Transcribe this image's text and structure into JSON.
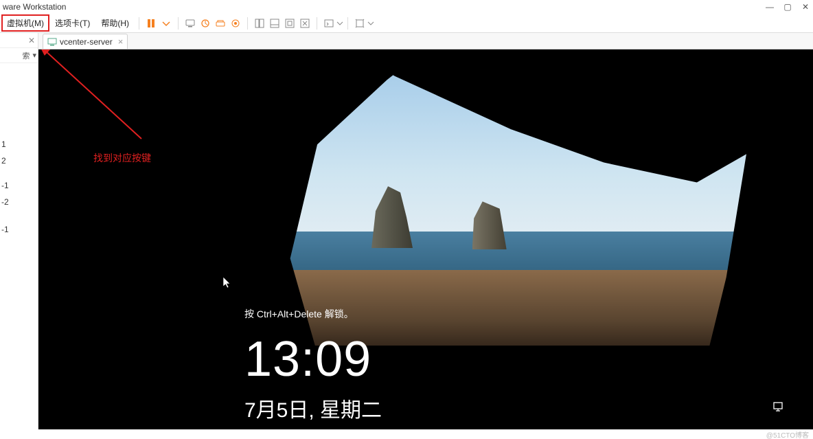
{
  "app": {
    "title": "ware Workstation"
  },
  "menu": {
    "vm": "虚拟机(M)",
    "tabs": "选项卡(T)",
    "help": "帮助(H)"
  },
  "sidebar": {
    "search_label": "索",
    "items": [
      "1",
      "2",
      "",
      "-1",
      "-2",
      "",
      "-1"
    ]
  },
  "tab": {
    "name": "vcenter-server"
  },
  "lockscreen": {
    "hint": "按 Ctrl+Alt+Delete 解锁。",
    "time": "13:09",
    "date": "7月5日, 星期二"
  },
  "annotation": {
    "label": "找到对应按键"
  },
  "watermark": "@51CTO博客"
}
